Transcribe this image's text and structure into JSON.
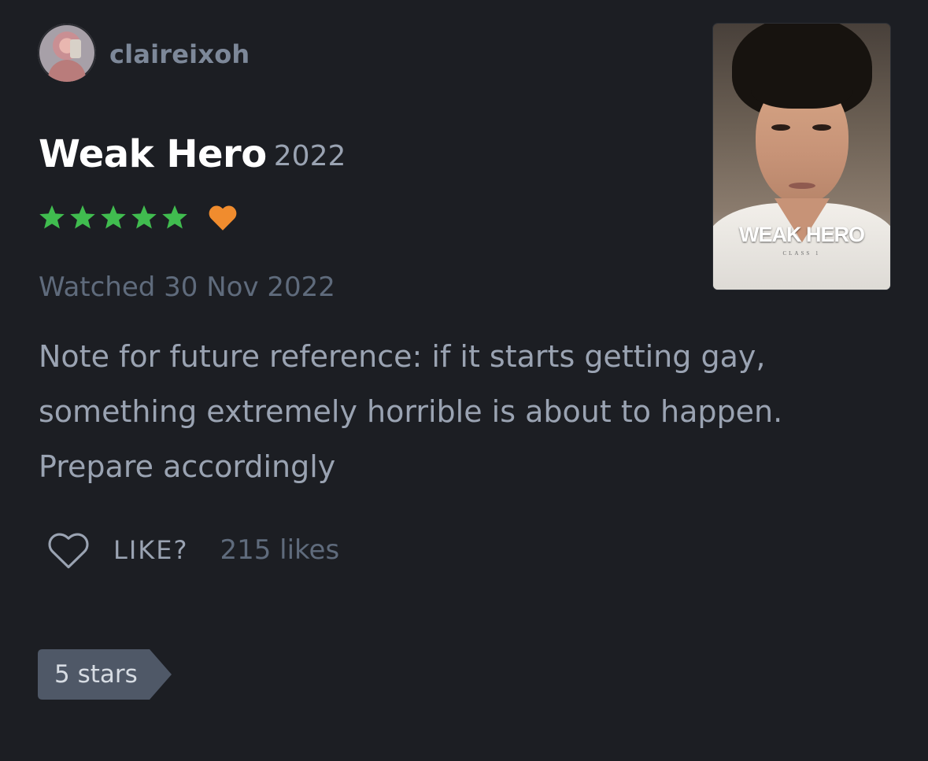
{
  "user": {
    "username": "claireixoh",
    "avatar_icon": "profile-photo"
  },
  "film": {
    "title": "Weak Hero",
    "year": "2022",
    "poster_title": "WEAK HERO",
    "poster_subtitle": "CLASS 1"
  },
  "rating": {
    "stars": 5,
    "max_stars": 5,
    "star_color": "#40bc4f",
    "liked": true,
    "liked_heart_color": "#f08c2e",
    "star_icon": "star-icon",
    "liked_icon": "heart-filled-icon"
  },
  "watched": {
    "label": "Watched 30 Nov 2022"
  },
  "review": {
    "text": "Note for future reference: if it starts getting gay, something extremely horrible is about to happen. Prepare accordingly"
  },
  "likes": {
    "button_label": "LIKE?",
    "count_label": "215 likes",
    "icon": "heart-outline-icon"
  },
  "tag": {
    "label": "5 stars",
    "color": "#4f5867"
  },
  "colors": {
    "background": "#1c1e23",
    "primary_text": "#ffffff",
    "secondary_text": "#9aa3b2",
    "muted_text": "#5f6b7c"
  }
}
